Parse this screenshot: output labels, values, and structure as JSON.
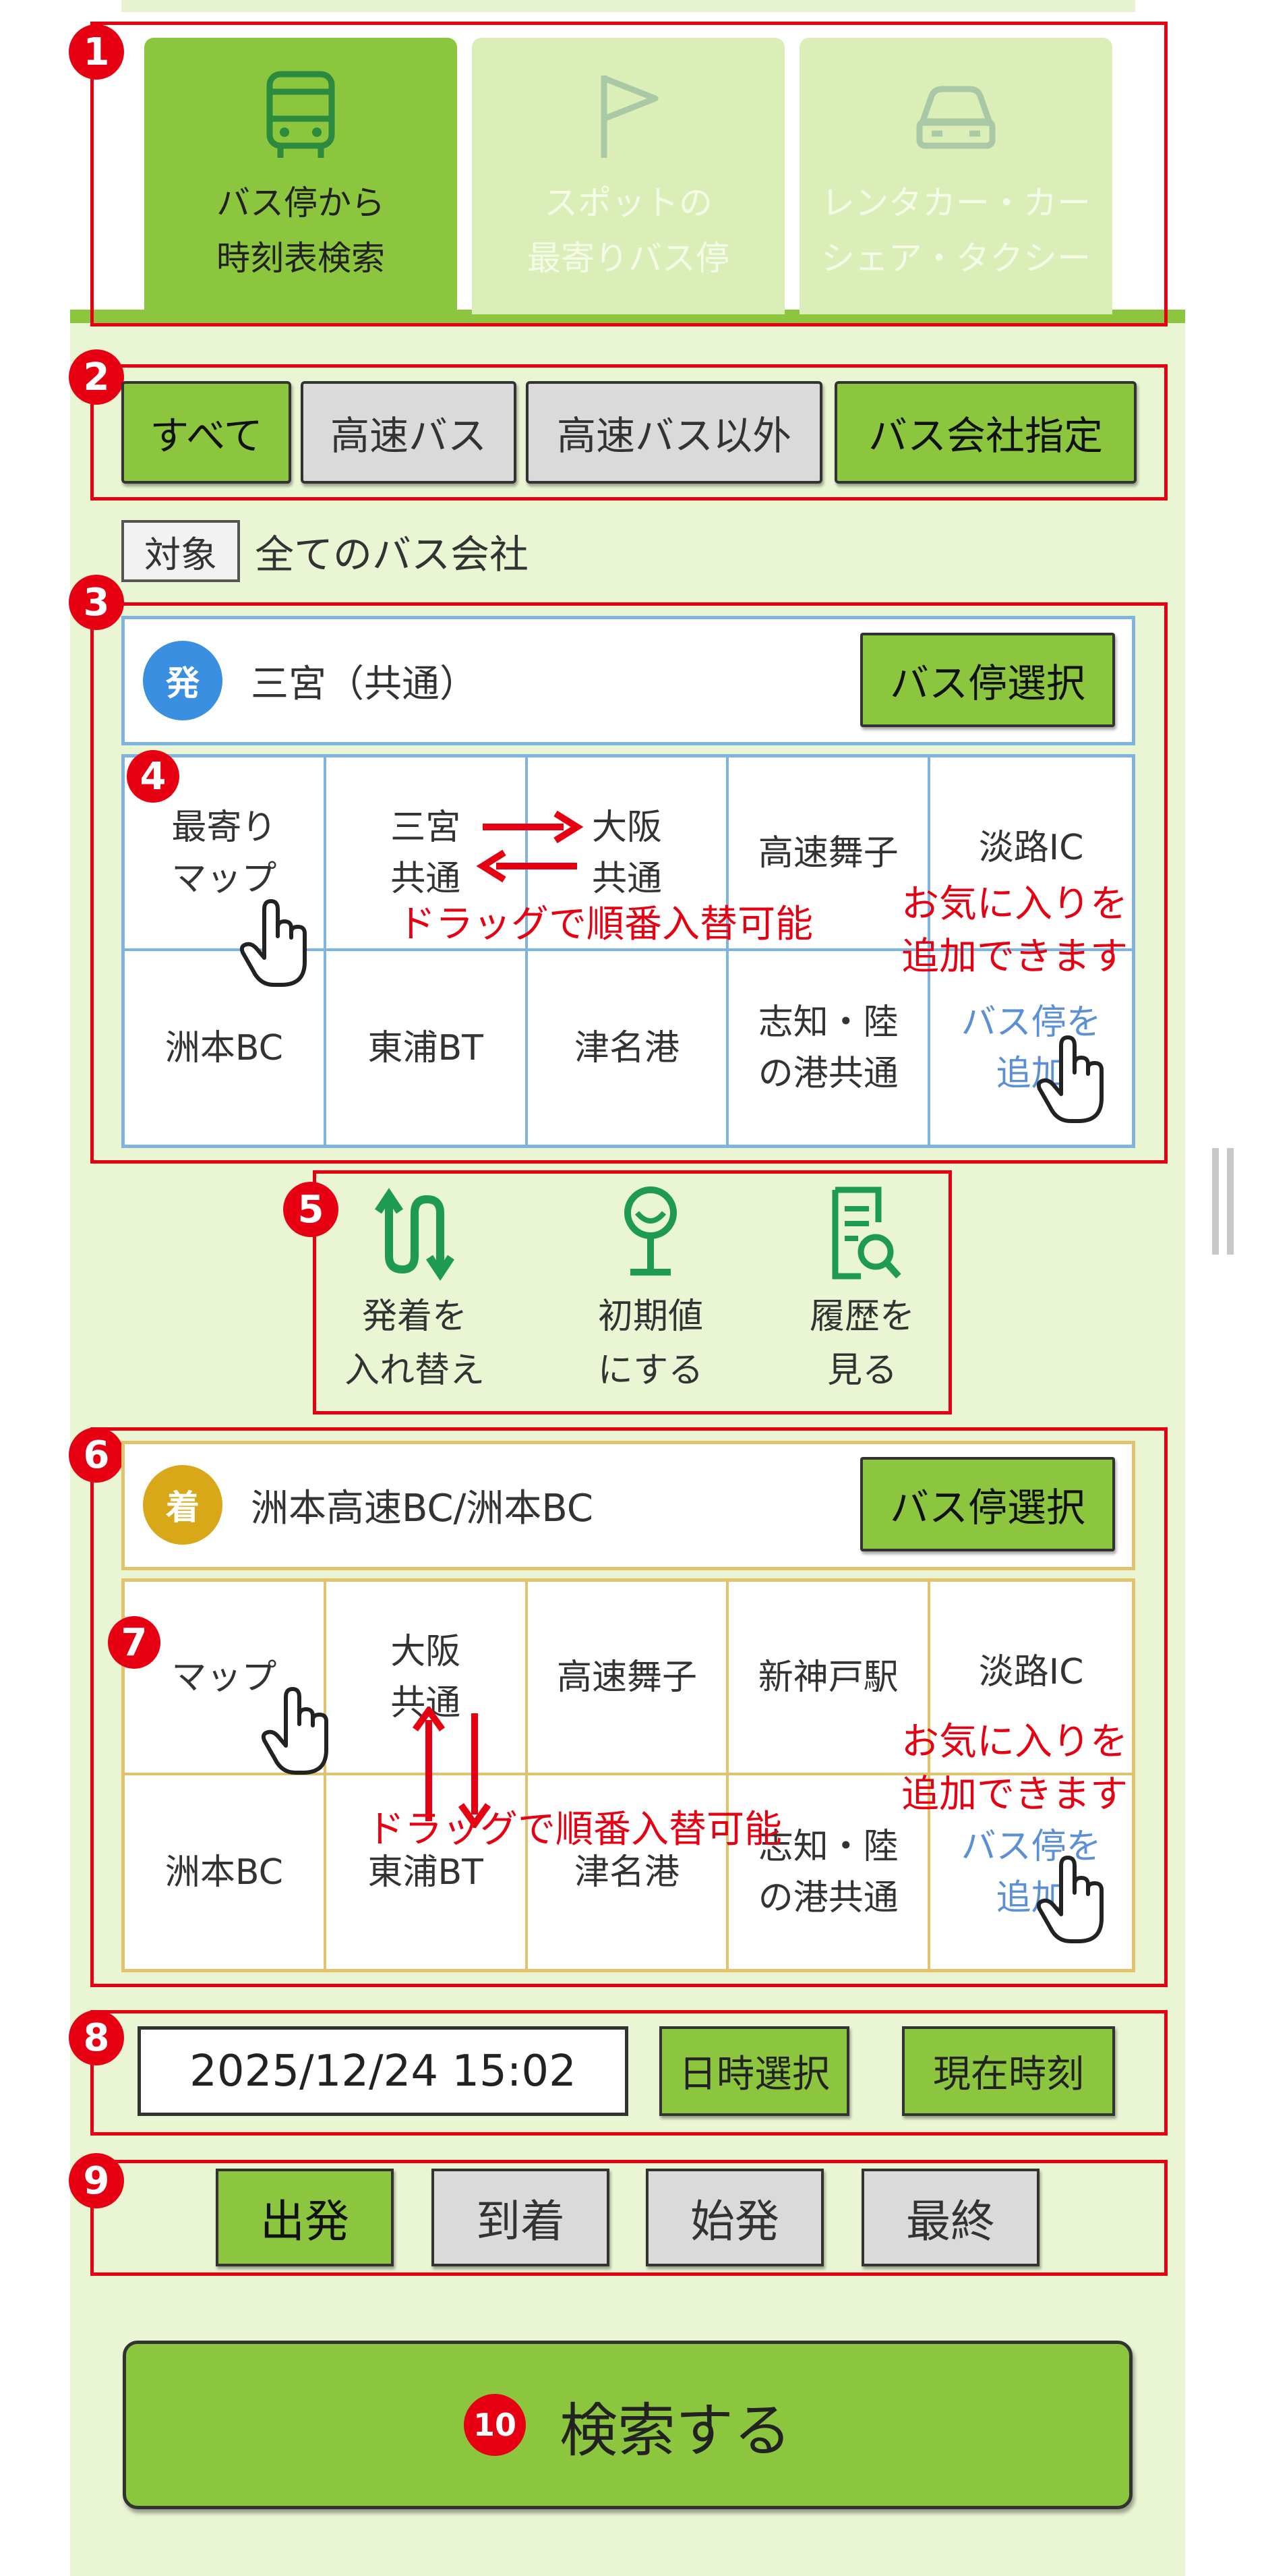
{
  "colors": {
    "accent_green": "#8cc63f",
    "annotation_red": "#e60012",
    "departure_blue": "#3a8fe0",
    "arrival_gold": "#d9a818",
    "link_blue": "#5b8fd6",
    "background": "#eaf5d3"
  },
  "tabs": [
    {
      "label": "バス停から\n時刻表検索",
      "icon": "bus-icon",
      "active": true
    },
    {
      "label": "スポットの\n最寄りバス停",
      "icon": "flag-icon",
      "active": false
    },
    {
      "label": "レンタカー・カー\nシェア・タクシー",
      "icon": "car-icon",
      "active": false
    }
  ],
  "filters": [
    {
      "label": "すべて",
      "active": true
    },
    {
      "label": "高速バス",
      "active": false
    },
    {
      "label": "高速バス以外",
      "active": false
    },
    {
      "label": "バス会社指定",
      "active": true
    }
  ],
  "target": {
    "label": "対象",
    "value": "全てのバス会社"
  },
  "departure": {
    "badge": "発",
    "stop": "三宮（共通）",
    "select_label": "バス停選択",
    "grid": [
      "最寄り\nマップ",
      "三宮\n共通",
      "大阪\n共通",
      "高速舞子",
      "淡路IC",
      "洲本BC",
      "東浦BT",
      "津名港",
      "志知・陸\nの港共通",
      "バス停を\n追加"
    ]
  },
  "arrival": {
    "badge": "着",
    "stop": "洲本高速BC/洲本BC",
    "select_label": "バス停選択",
    "grid": [
      "マップ",
      "大阪\n共通",
      "高速舞子",
      "新神戸駅",
      "淡路IC",
      "洲本BC",
      "東浦BT",
      "津名港",
      "志知・陸\nの港共通",
      "バス停を\n追加"
    ]
  },
  "annotations": {
    "drag_note": "ドラッグで順番入替可能",
    "fav_note": "お気に入りを\n追加できます"
  },
  "actions": [
    {
      "label": "発着を\n入れ替え",
      "icon": "swap-icon"
    },
    {
      "label": "初期値\nにする",
      "icon": "reset-icon"
    },
    {
      "label": "履歴を\n見る",
      "icon": "history-icon"
    }
  ],
  "datetime": {
    "value": "2025/12/24 15:02",
    "select_label": "日時選択",
    "now_label": "現在時刻"
  },
  "search_types": [
    {
      "label": "出発",
      "active": true
    },
    {
      "label": "到着",
      "active": false
    },
    {
      "label": "始発",
      "active": false
    },
    {
      "label": "最終",
      "active": false
    }
  ],
  "search_button": {
    "label": "検索する"
  },
  "section_numbers": [
    "1",
    "2",
    "3",
    "4",
    "5",
    "6",
    "7",
    "8",
    "9",
    "10"
  ]
}
